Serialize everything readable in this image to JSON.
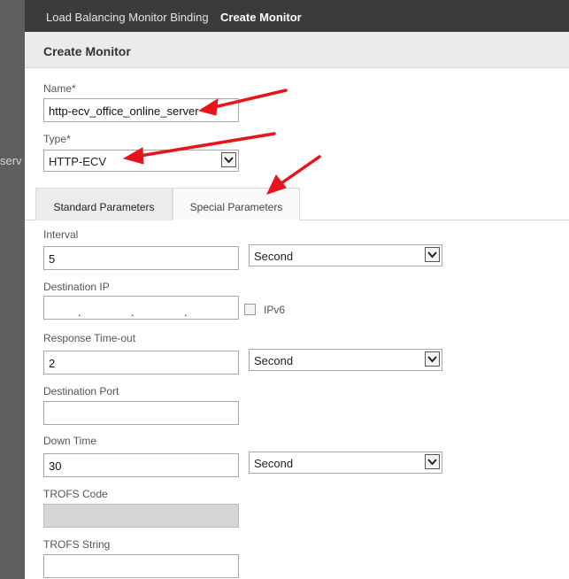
{
  "backdrop": {
    "text": "serv"
  },
  "breadcrumb": {
    "parent": "Load Balancing Monitor Binding",
    "current": "Create Monitor"
  },
  "panel": {
    "title": "Create Monitor"
  },
  "name": {
    "label": "Name*",
    "value": "http-ecv_office_online_server"
  },
  "type": {
    "label": "Type*",
    "value": "HTTP-ECV"
  },
  "tabs": {
    "standard": "Standard Parameters",
    "special": "Special Parameters"
  },
  "interval": {
    "label": "Interval",
    "value": "5",
    "unit": "Second"
  },
  "destination_ip": {
    "label": "Destination IP",
    "ipv6_label": "IPv6"
  },
  "response_timeout": {
    "label": "Response Time-out",
    "value": "2",
    "unit": "Second"
  },
  "destination_port": {
    "label": "Destination Port",
    "value": ""
  },
  "down_time": {
    "label": "Down Time",
    "value": "30",
    "unit": "Second"
  },
  "trofs_code": {
    "label": "TROFS Code",
    "value": ""
  },
  "trofs_string": {
    "label": "TROFS String",
    "value": ""
  },
  "annotation_color": "#e8141b"
}
